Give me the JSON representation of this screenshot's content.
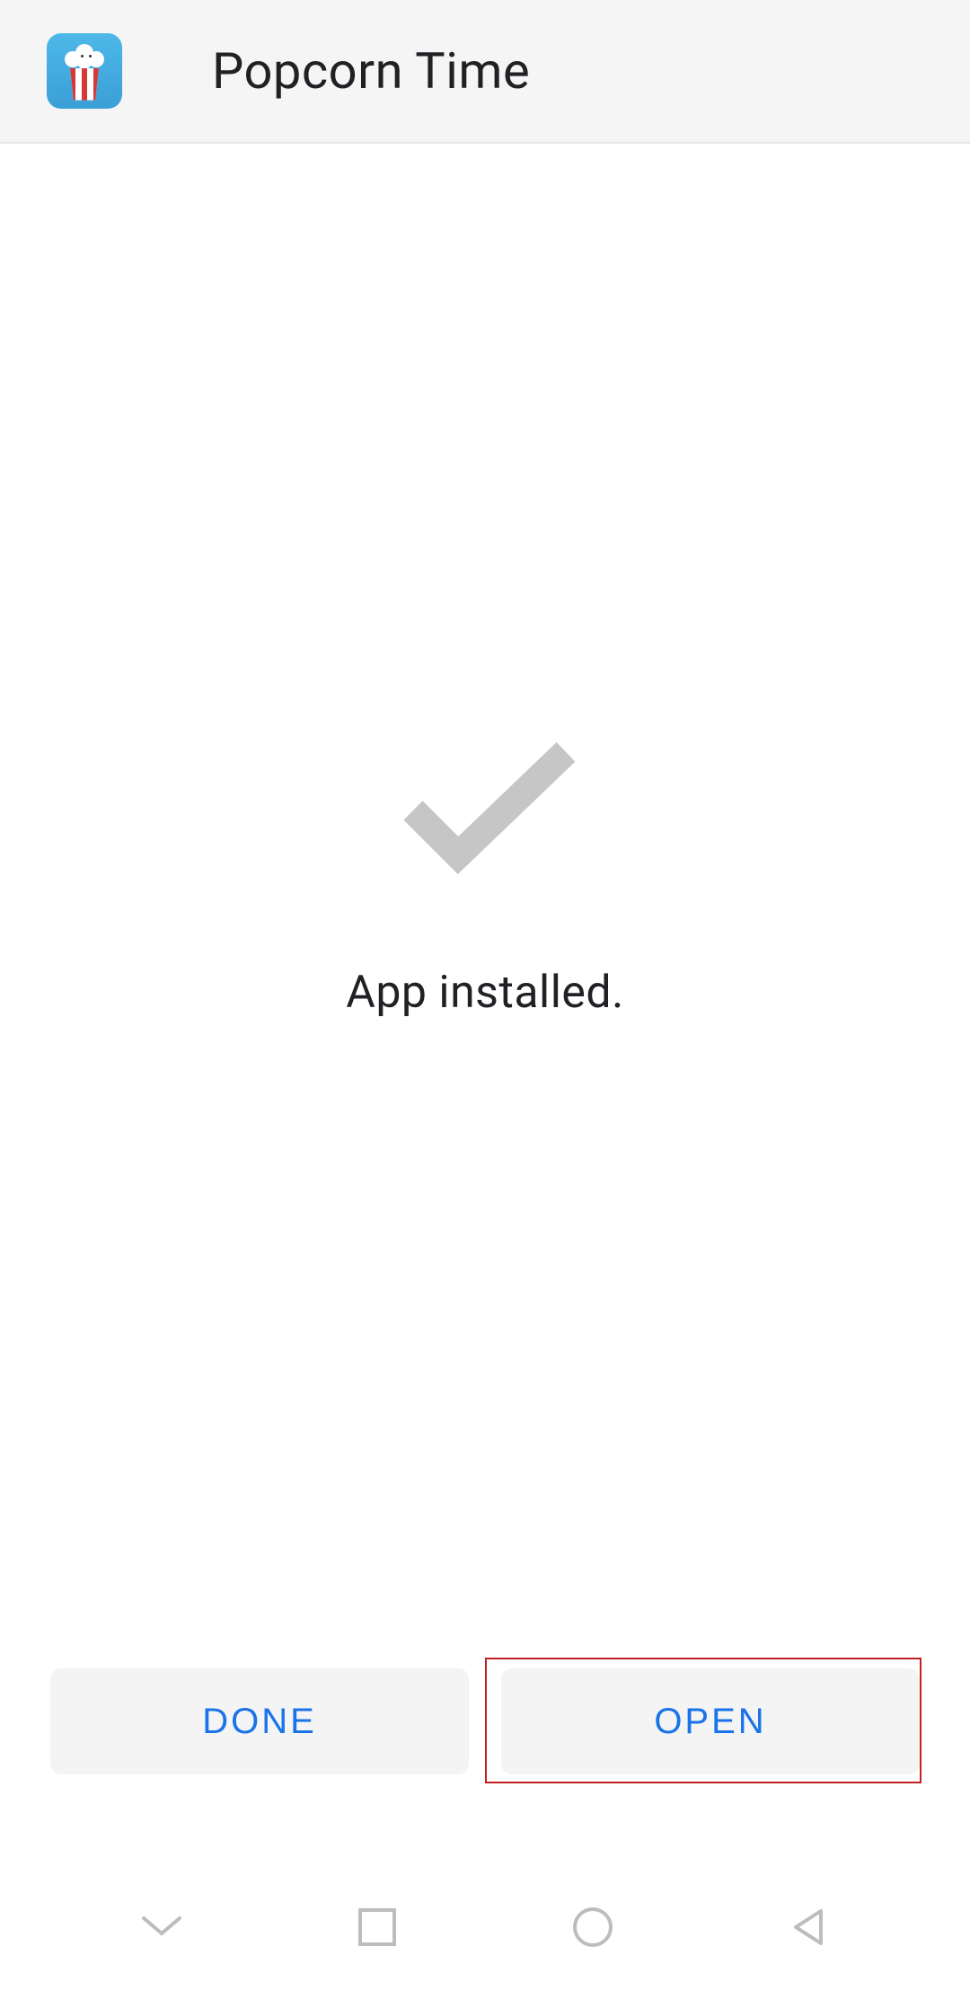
{
  "header": {
    "app_name": "Popcorn Time",
    "icon_name": "popcorn-time-app-icon"
  },
  "content": {
    "status_message": "App installed.",
    "success_icon": "checkmark"
  },
  "buttons": {
    "done_label": "DONE",
    "open_label": "OPEN"
  },
  "highlight": {
    "target": "open-button",
    "color": "#c02020"
  },
  "navigation": {
    "items": [
      "keyboard-down",
      "recent-apps",
      "home",
      "back"
    ]
  },
  "colors": {
    "accent": "#1a73e8",
    "header_bg": "#f5f5f5",
    "button_bg": "#f4f4f4",
    "text_primary": "#202124",
    "icon_muted": "#bdbdbd"
  }
}
